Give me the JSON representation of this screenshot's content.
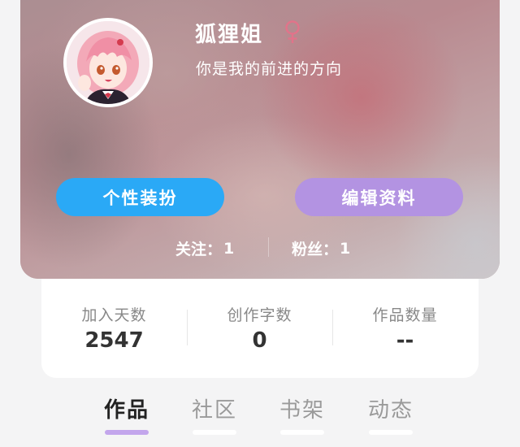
{
  "profile": {
    "name": "狐狸姐",
    "gender_icon": "female-symbol-icon",
    "bio": "你是我的前进的方向",
    "avatar_icon": "anime-girl-avatar",
    "buttons": {
      "dressup_label": "个性装扮",
      "edit_label": "编辑资料"
    },
    "follow": {
      "following_label": "关注：",
      "following_value": "1",
      "fans_label": "粉丝：",
      "fans_value": "1"
    }
  },
  "stats": [
    {
      "label": "加入天数",
      "value": "2547"
    },
    {
      "label": "创作字数",
      "value": "0"
    },
    {
      "label": "作品数量",
      "value": "--"
    }
  ],
  "tabs": [
    {
      "label": "作品",
      "active": true
    },
    {
      "label": "社区",
      "active": false
    },
    {
      "label": "书架",
      "active": false
    },
    {
      "label": "动态",
      "active": false
    }
  ],
  "colors": {
    "dressup_button": "#2aa9f6",
    "edit_button": "#b393e2",
    "gender_icon": "#e2738a",
    "tab_indicator": "#c3a6ec"
  }
}
